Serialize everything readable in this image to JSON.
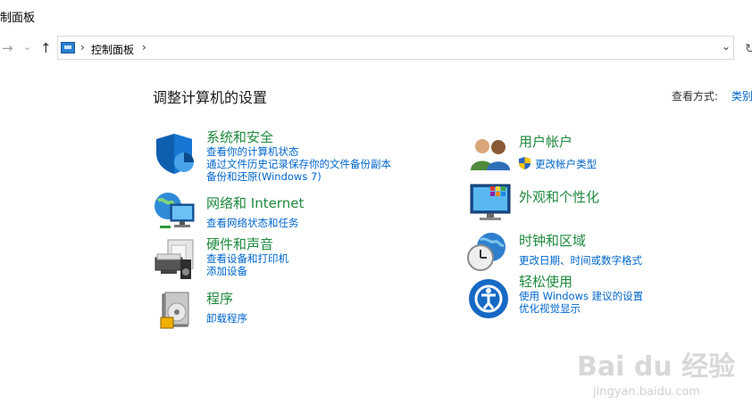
{
  "window": {
    "title": "制面板"
  },
  "nav": {
    "back": "→",
    "forward": "⌄",
    "up": "↑",
    "refresh": "↻"
  },
  "address": {
    "crumb": "控制面板",
    "sep": "›",
    "dropdown": "⌄"
  },
  "main": {
    "heading": "调整计算机的设置",
    "view_by_label": "查看方式:",
    "view_by_value": "类别"
  },
  "categories": {
    "system": {
      "title": "系统和安全",
      "links": [
        "查看你的计算机状态",
        "通过文件历史记录保存你的文件备份副本",
        "备份和还原(Windows 7)"
      ]
    },
    "network": {
      "title": "网络和 Internet",
      "links": [
        "查看网络状态和任务"
      ]
    },
    "hardware": {
      "title": "硬件和声音",
      "links": [
        "查看设备和打印机",
        "添加设备"
      ]
    },
    "programs": {
      "title": "程序",
      "links": [
        "卸载程序"
      ]
    },
    "users": {
      "title": "用户帐户",
      "links": [
        "更改帐户类型"
      ]
    },
    "appearance": {
      "title": "外观和个性化"
    },
    "clock": {
      "title": "时钟和区域",
      "links": [
        "更改日期、时间或数字格式"
      ]
    },
    "access": {
      "title": "轻松使用",
      "links": [
        "使用 Windows 建议的设置",
        "优化视觉显示"
      ]
    }
  },
  "watermark": {
    "brand": "Bai du 经验",
    "url": "jingyan.baidu.com"
  },
  "colors": {
    "category_title": "#1e8a3d",
    "link": "#0066cc"
  }
}
